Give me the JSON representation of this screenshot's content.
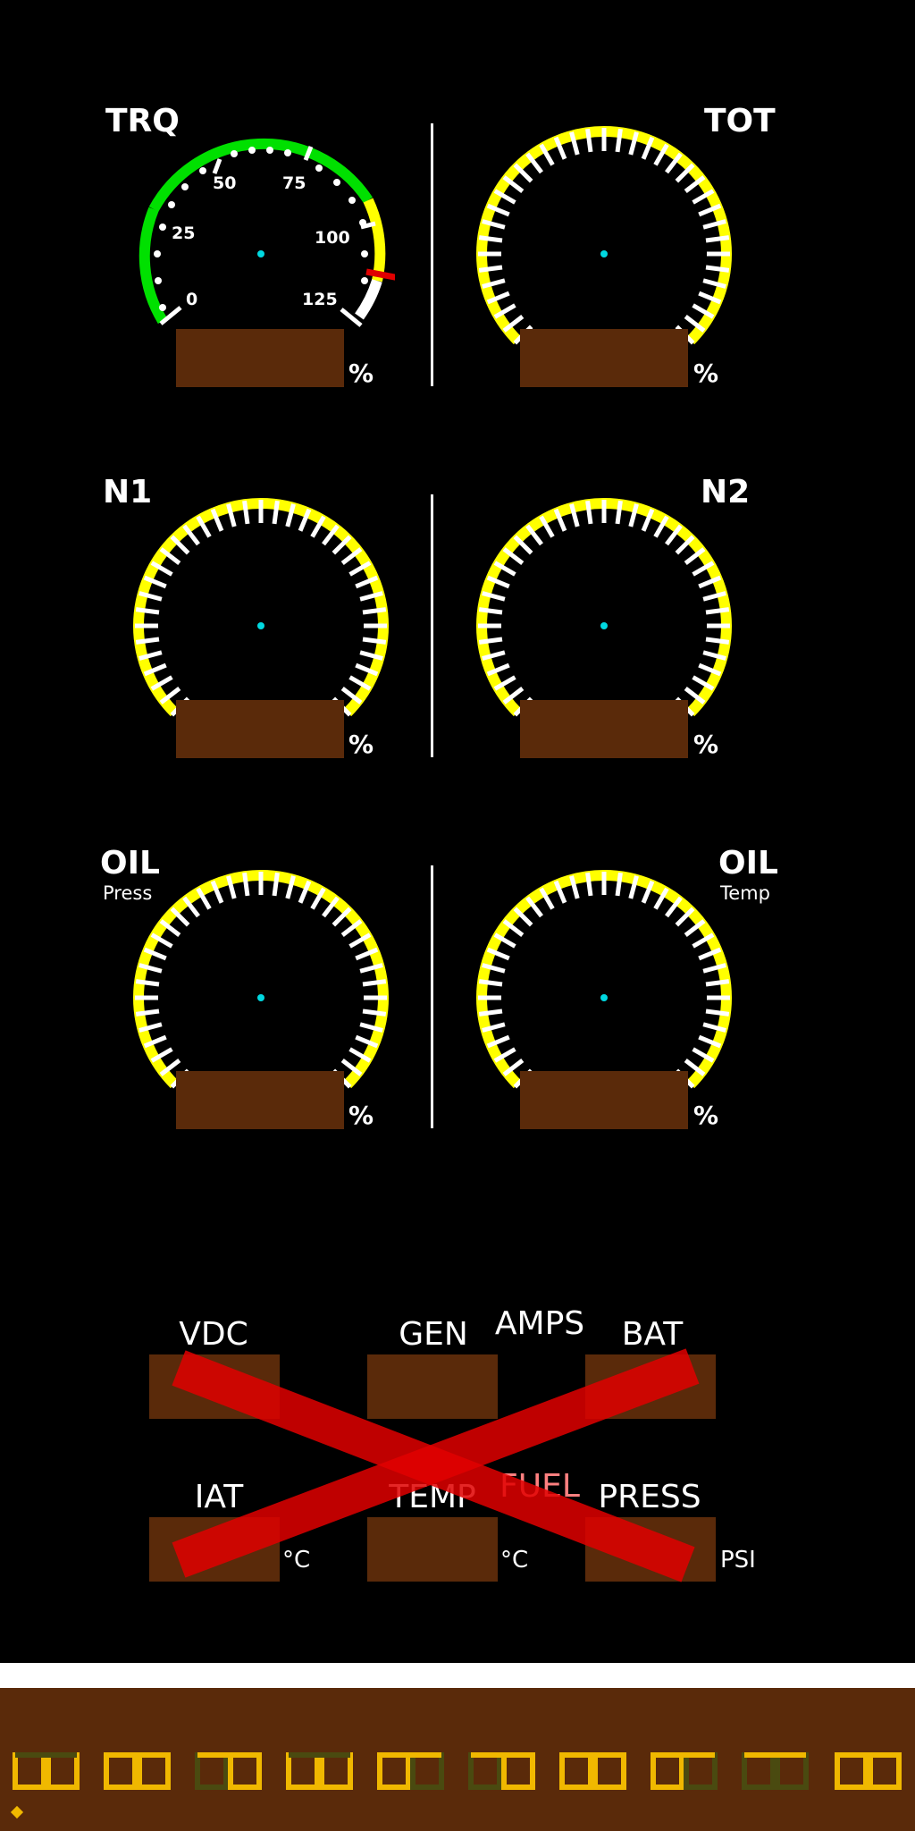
{
  "gauges": {
    "trq": {
      "label": "TRQ",
      "unit": "%",
      "ticks": [
        "0",
        "25",
        "50",
        "75",
        "100",
        "125"
      ]
    },
    "tot": {
      "label": "TOT",
      "unit": "%"
    },
    "n1": {
      "label": "N1",
      "unit": "%"
    },
    "n2": {
      "label": "N2",
      "unit": "%"
    },
    "oil_press": {
      "label": "OIL",
      "sublabel": "Press",
      "unit": "%"
    },
    "oil_temp": {
      "label": "OIL",
      "sublabel": "Temp",
      "unit": "%"
    }
  },
  "electrical": {
    "vdc": "VDC",
    "gen": "GEN",
    "amps": "AMPS",
    "bat": "BAT",
    "iat": "IAT",
    "temp": "TEMP",
    "fuel": "FUEL",
    "press": "PRESS",
    "iat_unit": "°C",
    "temp_unit": "°C",
    "press_unit": "PSI"
  },
  "colors": {
    "green_arc": "#00e000",
    "yellow_arc": "#ffff00",
    "readout_bg": "#5a2a0a",
    "center_dot": "#00d8e0",
    "red_x": "#e00000",
    "segment_on": "#f0b800",
    "segment_dim": "#4a4a10"
  },
  "indicator_value_trq": 0.93
}
